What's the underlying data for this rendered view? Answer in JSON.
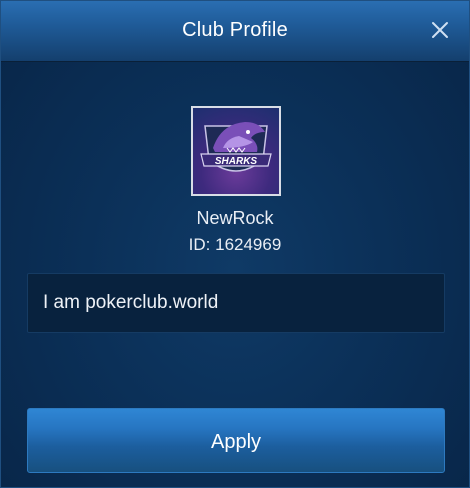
{
  "dialog": {
    "title": "Club Profile",
    "close_icon": "close-icon"
  },
  "club": {
    "logo_icon": "sharks-logo-icon",
    "logo_text": "SHARKS",
    "name": "NewRock",
    "id_text": "ID: 1624969",
    "description": "I am pokerclub.world"
  },
  "actions": {
    "apply_label": "Apply"
  },
  "colors": {
    "header": "#1f5b98",
    "background": "#0b3058",
    "button": "#2776c2",
    "logo_purple": "#6b3b9a"
  }
}
